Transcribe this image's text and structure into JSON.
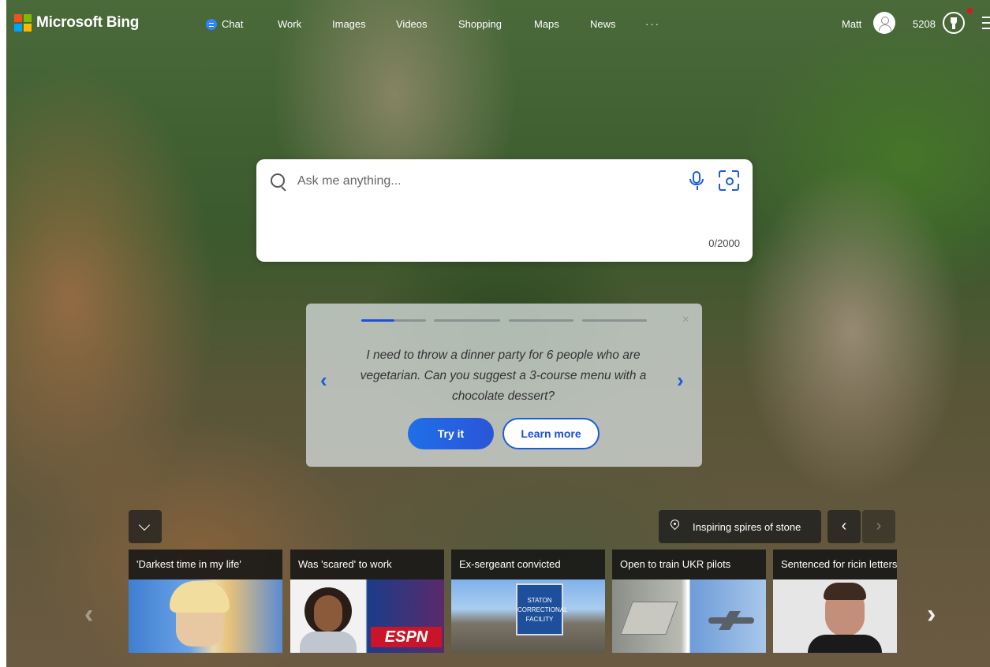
{
  "header": {
    "brand": "Microsoft Bing",
    "nav": [
      {
        "label": "Chat",
        "icon": "chat-icon"
      },
      {
        "label": "Work"
      },
      {
        "label": "Images"
      },
      {
        "label": "Videos"
      },
      {
        "label": "Shopping"
      },
      {
        "label": "Maps"
      },
      {
        "label": "News"
      },
      {
        "label": "···"
      }
    ],
    "user": {
      "name": "Matt",
      "points": "5208"
    }
  },
  "search": {
    "placeholder": "Ask me anything...",
    "value": "",
    "char_count": "0/2000"
  },
  "promo": {
    "text": "I need to throw a dinner party for 6 people who are vegetarian. Can you suggest a 3-course menu with a chocolate dessert?",
    "try_label": "Try it",
    "learn_label": "Learn more",
    "close_label": "×",
    "prev_label": "‹",
    "next_label": "›",
    "progress_steps": 4,
    "active_step": 1
  },
  "image_info": {
    "title": "Inspiring spires of stone",
    "prev_label": "‹",
    "next_label": "›"
  },
  "news": {
    "prev_label": "‹",
    "next_label": "›",
    "items": [
      {
        "title": "'Darkest time in my life'"
      },
      {
        "title": "Was 'scared' to work"
      },
      {
        "title": "Ex-sergeant convicted",
        "sign_text": [
          "STATON",
          "CORRECTIONAL",
          "FACILITY"
        ]
      },
      {
        "title": "Open to train UKR pilots"
      },
      {
        "title": "Sentenced for ricin letters"
      }
    ]
  },
  "colors": {
    "accent": "#1a5fd8",
    "brand_red": "#f25022",
    "brand_green": "#7fba00",
    "brand_blue": "#00a4ef",
    "brand_yellow": "#ffb900"
  }
}
